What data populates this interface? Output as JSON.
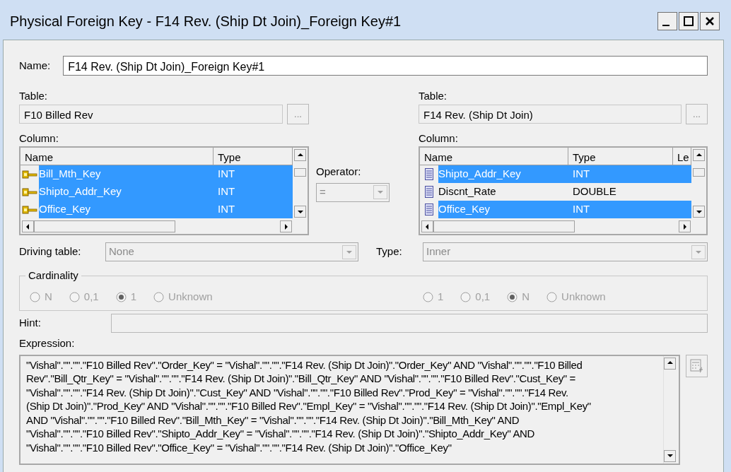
{
  "window": {
    "title": "Physical Foreign Key - F14 Rev. (Ship Dt Join)_Foreign Key#1"
  },
  "name": {
    "label": "Name:",
    "value": "F14 Rev. (Ship Dt Join)_Foreign Key#1"
  },
  "left": {
    "table_label": "Table:",
    "table": "F10 Billed Rev",
    "browse": "...",
    "column_label": "Column:",
    "columns": [
      "Name",
      "Type"
    ],
    "rows": [
      {
        "kind": "key",
        "name": "Bill_Mth_Key",
        "type": "INT",
        "selected": true
      },
      {
        "kind": "key",
        "name": "Shipto_Addr_Key",
        "type": "INT",
        "selected": true
      },
      {
        "kind": "key",
        "name": "Office_Key",
        "type": "INT",
        "selected": true
      }
    ]
  },
  "operator": {
    "label": "Operator:",
    "value": "=",
    "disabled": true
  },
  "right": {
    "table_label": "Table:",
    "table": "F14 Rev. (Ship Dt Join)",
    "browse": "...",
    "column_label": "Column:",
    "columns": [
      "Name",
      "Type",
      "Le"
    ],
    "rows": [
      {
        "kind": "column",
        "name": "Shipto_Addr_Key",
        "type": "INT",
        "selected": true
      },
      {
        "kind": "column",
        "name": "Discnt_Rate",
        "type": "DOUBLE",
        "selected": false
      },
      {
        "kind": "column",
        "name": "Office_Key",
        "type": "INT",
        "selected": true
      }
    ]
  },
  "driving_table": {
    "label": "Driving table:",
    "value": "None",
    "disabled": true
  },
  "join_type": {
    "label": "Type:",
    "value": "Inner",
    "disabled": true
  },
  "cardinality": {
    "label": "Cardinality",
    "disabled": true,
    "left": [
      {
        "label": "N",
        "selected": false
      },
      {
        "label": "0,1",
        "selected": false
      },
      {
        "label": "1",
        "selected": true
      },
      {
        "label": "Unknown",
        "selected": false
      }
    ],
    "right": [
      {
        "label": "1",
        "selected": false
      },
      {
        "label": "0,1",
        "selected": false
      },
      {
        "label": "N",
        "selected": true
      },
      {
        "label": "Unknown",
        "selected": false
      }
    ]
  },
  "hint": {
    "label": "Hint:"
  },
  "expression": {
    "label": "Expression:",
    "lines": [
      "\"Vishal\".\"\".\"\".\"F10 Billed Rev\".\"Order_Key\" = \"Vishal\".\"\".\"\".\"F14 Rev. (Ship Dt Join)\".\"Order_Key\" AND \"Vishal\".\"\".\"\".\"F10 Billed",
      "Rev\".\"Bill_Qtr_Key\" = \"Vishal\".\"\".\"\".\"F14 Rev. (Ship Dt Join)\".\"Bill_Qtr_Key\" AND \"Vishal\".\"\".\"\".\"F10 Billed Rev\".\"Cust_Key\" =",
      "\"Vishal\".\"\".\"\".\"F14 Rev. (Ship Dt Join)\".\"Cust_Key\" AND \"Vishal\".\"\".\"\".\"F10 Billed Rev\".\"Prod_Key\" = \"Vishal\".\"\".\"\".\"F14 Rev.",
      "(Ship Dt Join)\".\"Prod_Key\" AND \"Vishal\".\"\".\"\".\"F10 Billed Rev\".\"Empl_Key\" = \"Vishal\".\"\".\"\".\"F14 Rev. (Ship Dt Join)\".\"Empl_Key\"",
      "AND \"Vishal\".\"\".\"\".\"F10 Billed Rev\".\"Bill_Mth_Key\" = \"Vishal\".\"\".\"\".\"F14 Rev. (Ship Dt Join)\".\"Bill_Mth_Key\" AND",
      "\"Vishal\".\"\".\"\".\"F10 Billed Rev\".\"Shipto_Addr_Key\" = \"Vishal\".\"\".\"\".\"F14 Rev. (Ship Dt Join)\".\"Shipto_Addr_Key\" AND",
      "\"Vishal\".\"\".\"\".\"F10 Billed Rev\".\"Office_Key\" = \"Vishal\".\"\".\"\".\"F14 Rev. (Ship Dt Join)\".\"Office_Key\""
    ]
  }
}
